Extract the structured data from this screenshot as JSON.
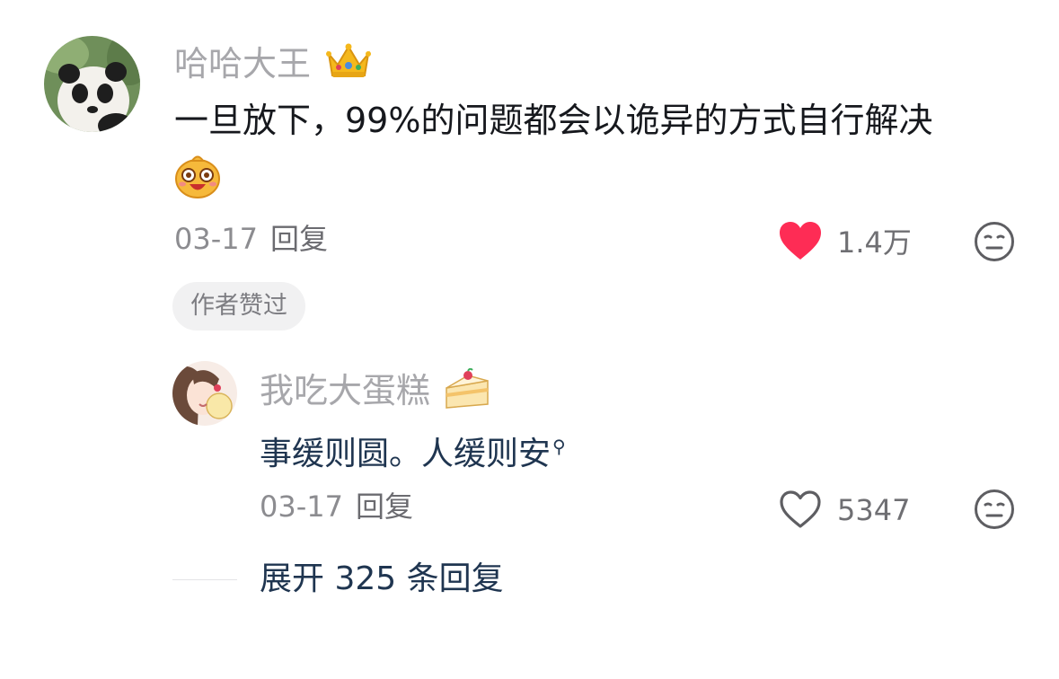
{
  "comment": {
    "username": "哈哈大王",
    "username_emoji": "crown-icon",
    "text": "一旦放下，99%的问题都会以诡异的方式自行解决",
    "emoji": "laughing-face-icon",
    "date": "03-17",
    "reply_label": "回复",
    "like_count": "1.4万",
    "liked": true,
    "author_badge": "作者赞过"
  },
  "reply": {
    "username": "我吃大蛋糕",
    "username_emoji": "cake-icon",
    "text": "事缓则圆。人缓则安",
    "date": "03-17",
    "reply_label": "回复",
    "like_count": "5347",
    "liked": false
  },
  "expand_label": "展开 325 条回复",
  "colors": {
    "like_active": "#fe2c55",
    "link_blue": "#1f3550"
  }
}
